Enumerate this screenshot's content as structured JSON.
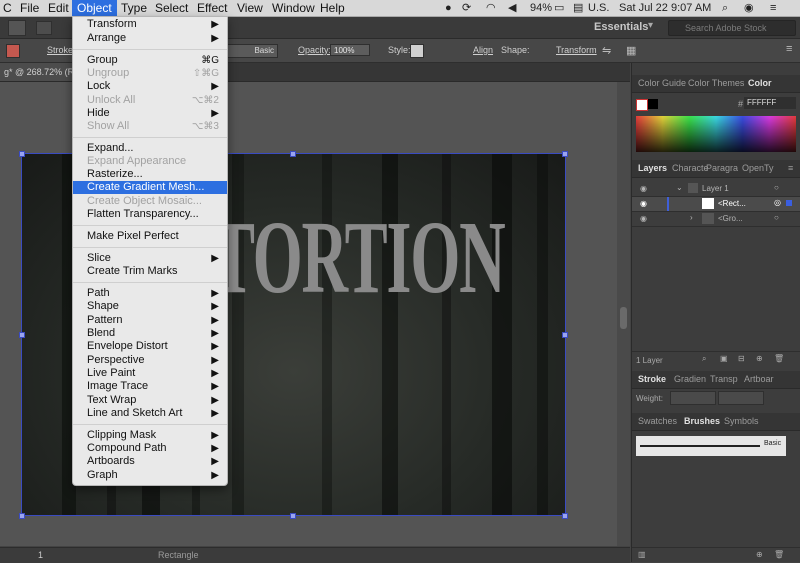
{
  "menubar": {
    "apple": "",
    "items": [
      {
        "label": "C"
      },
      {
        "label": "File"
      },
      {
        "label": "Edit"
      },
      {
        "label": "Object"
      },
      {
        "label": "Type"
      },
      {
        "label": "Select"
      },
      {
        "label": "Effect"
      },
      {
        "label": "View"
      },
      {
        "label": "Window"
      },
      {
        "label": "Help"
      }
    ],
    "status": {
      "battery": "94%",
      "input_source": "U.S.",
      "clock": "Sat Jul 22  9:07 AM"
    }
  },
  "appbar": {
    "workspace": "Essentials",
    "search_placeholder": "Search Adobe Stock"
  },
  "control": {
    "stroke_label": "Stroke:",
    "brush": "Basic",
    "opacity_label": "Opacity:",
    "opacity_value": "100%",
    "style_label": "Style:",
    "align_label": "Align",
    "shape_label": "Shape:",
    "transform_label": "Transform"
  },
  "document": {
    "tab_title": "g* @ 268.72% (RGB..."
  },
  "artwork": {
    "text": "TORTION"
  },
  "status_bar": {
    "zoom": "",
    "page": "1",
    "tool": "Rectangle"
  },
  "object_menu": {
    "items": [
      {
        "label": "Transform",
        "shortcut": "▶"
      },
      {
        "label": "Arrange",
        "shortcut": "▶"
      },
      {
        "label": "Group",
        "shortcut": "⌘G"
      },
      {
        "label": "Ungroup",
        "shortcut": "⇧⌘G"
      },
      {
        "label": "Lock",
        "shortcut": "▶"
      },
      {
        "label": "Unlock All",
        "shortcut": "⌥⌘2"
      },
      {
        "label": "Hide",
        "shortcut": "▶"
      },
      {
        "label": "Show All",
        "shortcut": "⌥⌘3"
      },
      {
        "label": "Expand...",
        "shortcut": ""
      },
      {
        "label": "Expand Appearance",
        "shortcut": ""
      },
      {
        "label": "Rasterize...",
        "shortcut": ""
      },
      {
        "label": "Create Gradient Mesh...",
        "shortcut": ""
      },
      {
        "label": "Create Object Mosaic...",
        "shortcut": ""
      },
      {
        "label": "Flatten Transparency...",
        "shortcut": ""
      },
      {
        "label": "Make Pixel Perfect",
        "shortcut": ""
      },
      {
        "label": "Slice",
        "shortcut": "▶"
      },
      {
        "label": "Create Trim Marks",
        "shortcut": ""
      },
      {
        "label": "Path",
        "shortcut": "▶"
      },
      {
        "label": "Shape",
        "shortcut": "▶"
      },
      {
        "label": "Pattern",
        "shortcut": "▶"
      },
      {
        "label": "Blend",
        "shortcut": "▶"
      },
      {
        "label": "Envelope Distort",
        "shortcut": "▶"
      },
      {
        "label": "Perspective",
        "shortcut": "▶"
      },
      {
        "label": "Live Paint",
        "shortcut": "▶"
      },
      {
        "label": "Image Trace",
        "shortcut": "▶"
      },
      {
        "label": "Text Wrap",
        "shortcut": "▶"
      },
      {
        "label": "Line and Sketch Art",
        "shortcut": "▶"
      },
      {
        "label": "Clipping Mask",
        "shortcut": "▶"
      },
      {
        "label": "Compound Path",
        "shortcut": "▶"
      },
      {
        "label": "Artboards",
        "shortcut": "▶"
      },
      {
        "label": "Graph",
        "shortcut": "▶"
      }
    ]
  },
  "panels": {
    "color_tabs": [
      "Color Guide",
      "Color Themes",
      "Color"
    ],
    "hex_value": "FFFFFF",
    "layers_tabs": [
      "Layers",
      "Characte",
      "Paragra",
      "OpenTy"
    ],
    "layer_rows": [
      "Layer 1",
      "<Rect...",
      "<Gro..."
    ],
    "layers_count": "1 Layer",
    "stroke_tabs": [
      "Stroke",
      "Gradien",
      "Transp",
      "Artboar"
    ],
    "weight_label": "Weight:",
    "brush_tabs": [
      "Swatches",
      "Brushes",
      "Symbols"
    ],
    "brush_name": "Basic"
  },
  "colors": {
    "accent": "#2d6fe0",
    "selection": "#3a4bc2",
    "menu_bg": "#e9e9e9"
  }
}
